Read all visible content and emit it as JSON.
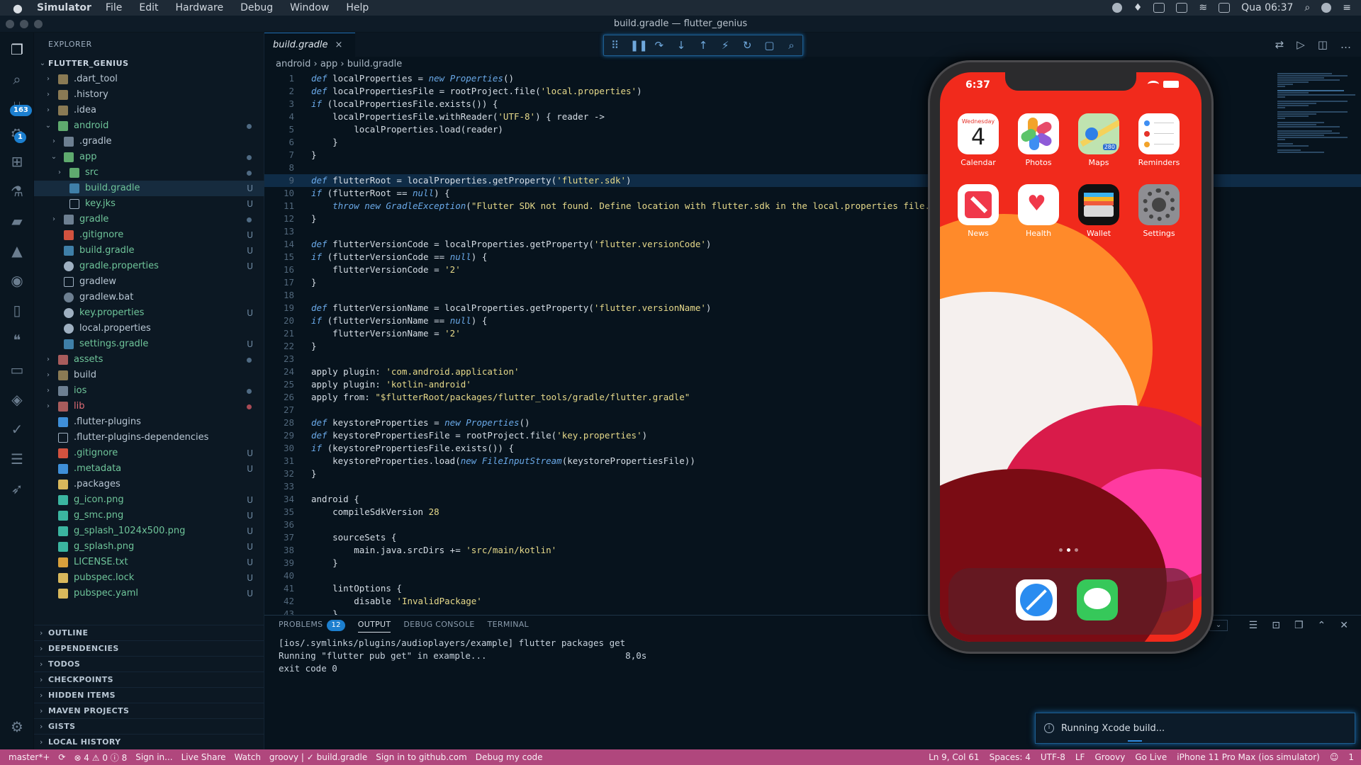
{
  "menubar": {
    "app": "Simulator",
    "menus": [
      "File",
      "Edit",
      "Hardware",
      "Debug",
      "Window",
      "Help"
    ],
    "clock": "Qua 06:37"
  },
  "window_title": "build.gradle — flutter_genius",
  "activity": {
    "badge_scm": "163",
    "badge_debug": "1"
  },
  "explorer": {
    "header": "EXPLORER",
    "project": "FLUTTER_GENIUS",
    "items": [
      {
        "label": ".dart_tool",
        "status": ""
      },
      {
        "label": ".history",
        "status": ""
      },
      {
        "label": ".idea",
        "status": ""
      },
      {
        "label": "android",
        "status": ""
      },
      {
        "label": ".gradle",
        "status": ""
      },
      {
        "label": "app",
        "status": ""
      },
      {
        "label": "src",
        "status": ""
      },
      {
        "label": "build.gradle",
        "status": "U"
      },
      {
        "label": "key.jks",
        "status": "U"
      },
      {
        "label": "gradle",
        "status": ""
      },
      {
        "label": ".gitignore",
        "status": "U"
      },
      {
        "label": "build.gradle",
        "status": "U"
      },
      {
        "label": "gradle.properties",
        "status": "U"
      },
      {
        "label": "gradlew",
        "status": ""
      },
      {
        "label": "gradlew.bat",
        "status": ""
      },
      {
        "label": "key.properties",
        "status": "U"
      },
      {
        "label": "local.properties",
        "status": ""
      },
      {
        "label": "settings.gradle",
        "status": "U"
      },
      {
        "label": "assets",
        "status": ""
      },
      {
        "label": "build",
        "status": ""
      },
      {
        "label": "ios",
        "status": ""
      },
      {
        "label": "lib",
        "status": ""
      },
      {
        "label": ".flutter-plugins",
        "status": ""
      },
      {
        "label": ".flutter-plugins-dependencies",
        "status": ""
      },
      {
        "label": ".gitignore",
        "status": "U"
      },
      {
        "label": ".metadata",
        "status": "U"
      },
      {
        "label": ".packages",
        "status": ""
      },
      {
        "label": "g_icon.png",
        "status": "U"
      },
      {
        "label": "g_smc.png",
        "status": "U"
      },
      {
        "label": "g_splash_1024x500.png",
        "status": "U"
      },
      {
        "label": "g_splash.png",
        "status": "U"
      },
      {
        "label": "LICENSE.txt",
        "status": "U"
      },
      {
        "label": "pubspec.lock",
        "status": "U"
      },
      {
        "label": "pubspec.yaml",
        "status": "U"
      }
    ],
    "sections": [
      "OUTLINE",
      "DEPENDENCIES",
      "TODOS",
      "CHECKPOINTS",
      "HIDDEN ITEMS",
      "MAVEN PROJECTS",
      "GISTS",
      "LOCAL HISTORY"
    ]
  },
  "editor": {
    "tab": "build.gradle",
    "breadcrumb": [
      "android",
      "app",
      "build.gradle"
    ],
    "lines": [
      "def localProperties = new Properties()",
      "def localPropertiesFile = rootProject.file('local.properties')",
      "if (localPropertiesFile.exists()) {",
      "    localPropertiesFile.withReader('UTF-8') { reader ->",
      "        localProperties.load(reader)",
      "    }",
      "}",
      "",
      "def flutterRoot = localProperties.getProperty('flutter.sdk')",
      "if (flutterRoot == null) {",
      "    throw new GradleException(\"Flutter SDK not found. Define location with flutter.sdk in the local.properties file.\")",
      "}",
      "",
      "def flutterVersionCode = localProperties.getProperty('flutter.versionCode')",
      "if (flutterVersionCode == null) {",
      "    flutterVersionCode = '2'",
      "}",
      "",
      "def flutterVersionName = localProperties.getProperty('flutter.versionName')",
      "if (flutterVersionName == null) {",
      "    flutterVersionName = '2'",
      "}",
      "",
      "apply plugin: 'com.android.application'",
      "apply plugin: 'kotlin-android'",
      "apply from: \"$flutterRoot/packages/flutter_tools/gradle/flutter.gradle\"",
      "",
      "def keystoreProperties = new Properties()",
      "def keystorePropertiesFile = rootProject.file('key.properties')",
      "if (keystorePropertiesFile.exists()) {",
      "    keystoreProperties.load(new FileInputStream(keystorePropertiesFile))",
      "}",
      "",
      "android {",
      "    compileSdkVersion 28",
      "",
      "    sourceSets {",
      "        main.java.srcDirs += 'src/main/kotlin'",
      "    }",
      "",
      "    lintOptions {",
      "        disable 'InvalidPackage'",
      "    }"
    ]
  },
  "panel": {
    "tabs": [
      "PROBLEMS",
      "OUTPUT",
      "DEBUG CONSOLE",
      "TERMINAL"
    ],
    "problems_count": "12",
    "output": "[ios/.symlinks/plugins/audioplayers/example] flutter packages get\nRunning \"flutter pub get\" in example...                          8,0s\nexit code 0"
  },
  "toast": "Running Xcode build...",
  "statusbar": {
    "left": [
      "master*+",
      "⊗ 4 ⚠ 0 ⓘ 8",
      "Sign in...",
      "Live Share",
      "Watch",
      "groovy | ✓ build.gradle",
      "Sign in to github.com",
      "Debug my code"
    ],
    "right": [
      "Ln 9, Col 61",
      "Spaces: 4",
      "UTF-8",
      "LF",
      "Groovy",
      "Go Live",
      "iPhone 11 Pro Max (ios simulator)",
      "1"
    ]
  },
  "phone": {
    "time": "6:37",
    "apps": [
      {
        "name": "Calendar",
        "day": "Wednesday",
        "date": "4"
      },
      {
        "name": "Photos"
      },
      {
        "name": "Maps",
        "badge": "280"
      },
      {
        "name": "Reminders"
      },
      {
        "name": "News"
      },
      {
        "name": "Health"
      },
      {
        "name": "Wallet"
      },
      {
        "name": "Settings"
      }
    ],
    "dock": [
      "Safari",
      "Messages"
    ]
  },
  "colors": {
    "status_bar": "#b0477d",
    "accent": "#1c7fcf"
  }
}
